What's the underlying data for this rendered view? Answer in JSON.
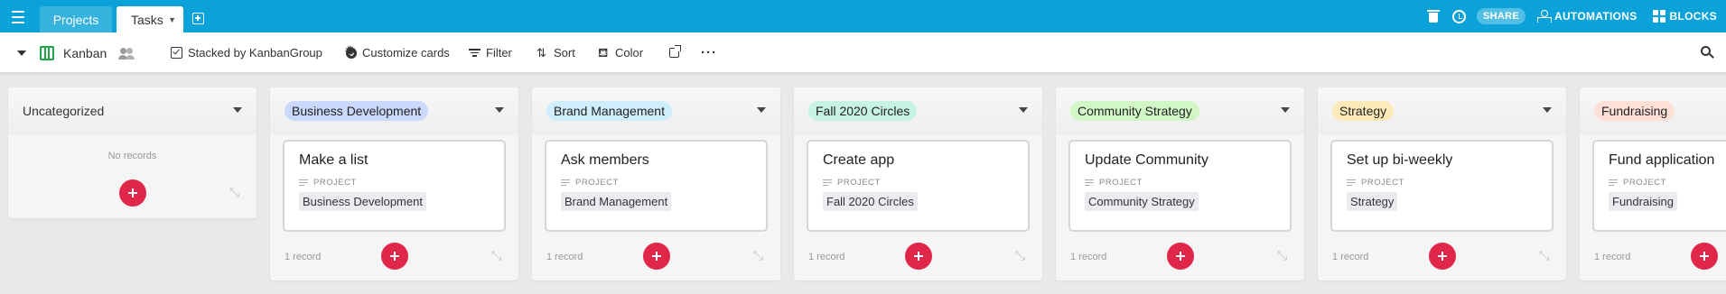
{
  "colors": {
    "accent": "#0aa2d8",
    "add_button": "#e0274a",
    "kanban_icon": "#20a74a"
  },
  "topbar": {
    "menu_icon": "hamburger-icon",
    "tabs": [
      {
        "label": "Projects"
      },
      {
        "label": "Tasks"
      }
    ],
    "share_label": "SHARE",
    "automations_label": "AUTOMATIONS",
    "blocks_label": "BLOCKS"
  },
  "viewbar": {
    "view_name": "Kanban",
    "stacked_by": "Stacked by KanbanGroup",
    "customize": "Customize cards",
    "filter": "Filter",
    "sort": "Sort",
    "color": "Color"
  },
  "stacks": [
    {
      "title": "Uncategorized",
      "empty_text": "No records"
    },
    {
      "title": "Business Development",
      "color": "#c9d8fb",
      "card_title": "Make a list",
      "field_label": "PROJECT",
      "field_value": "Business Development",
      "count": "1 record"
    },
    {
      "title": "Brand Management",
      "color": "#cfeefb",
      "card_title": "Ask members",
      "field_label": "PROJECT",
      "field_value": "Brand Management",
      "count": "1 record"
    },
    {
      "title": "Fall 2020 Circles",
      "color": "#c6f3e3",
      "card_title": "Create app",
      "field_label": "PROJECT",
      "field_value": "Fall 2020 Circles",
      "count": "1 record"
    },
    {
      "title": "Community Strategy",
      "color": "#d1f7c6",
      "card_title": "Update Community",
      "field_label": "PROJECT",
      "field_value": "Community Strategy",
      "count": "1 record"
    },
    {
      "title": "Strategy",
      "color": "#feeab9",
      "card_title": "Set up bi-weekly",
      "field_label": "PROJECT",
      "field_value": "Strategy",
      "count": "1 record"
    },
    {
      "title": "Fundraising",
      "color": "#fee0d7",
      "card_title": "Fund application",
      "field_label": "PROJECT",
      "field_value": "Fundraising",
      "count": "1 record"
    }
  ]
}
